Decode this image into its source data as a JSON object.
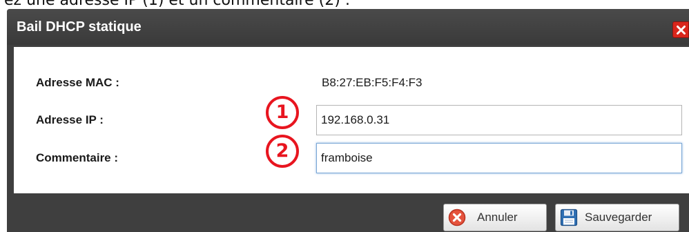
{
  "page": {
    "caption_fragment": "ez une adresse IP (1) et un commentaire (2) :"
  },
  "dialog": {
    "title": "Bail DHCP statique",
    "close_icon": "close-icon",
    "fields": {
      "mac_label": "Adresse MAC :",
      "mac_value": "B8:27:EB:F5:F4:F3",
      "ip_label": "Adresse IP :",
      "ip_value": "192.168.0.31",
      "comment_label": "Commentaire :",
      "comment_value": "framboise"
    },
    "markers": [
      "1",
      "2"
    ],
    "buttons": {
      "cancel_label": "Annuler",
      "cancel_icon": "cancel-icon",
      "save_label": "Sauvegarder",
      "save_icon": "floppy-disk-icon"
    }
  },
  "colors": {
    "dialog_frame": "#3f3f3f",
    "close_button": "#d9261c",
    "marker": "#e8151f",
    "focus_border": "#7aa7d6"
  }
}
